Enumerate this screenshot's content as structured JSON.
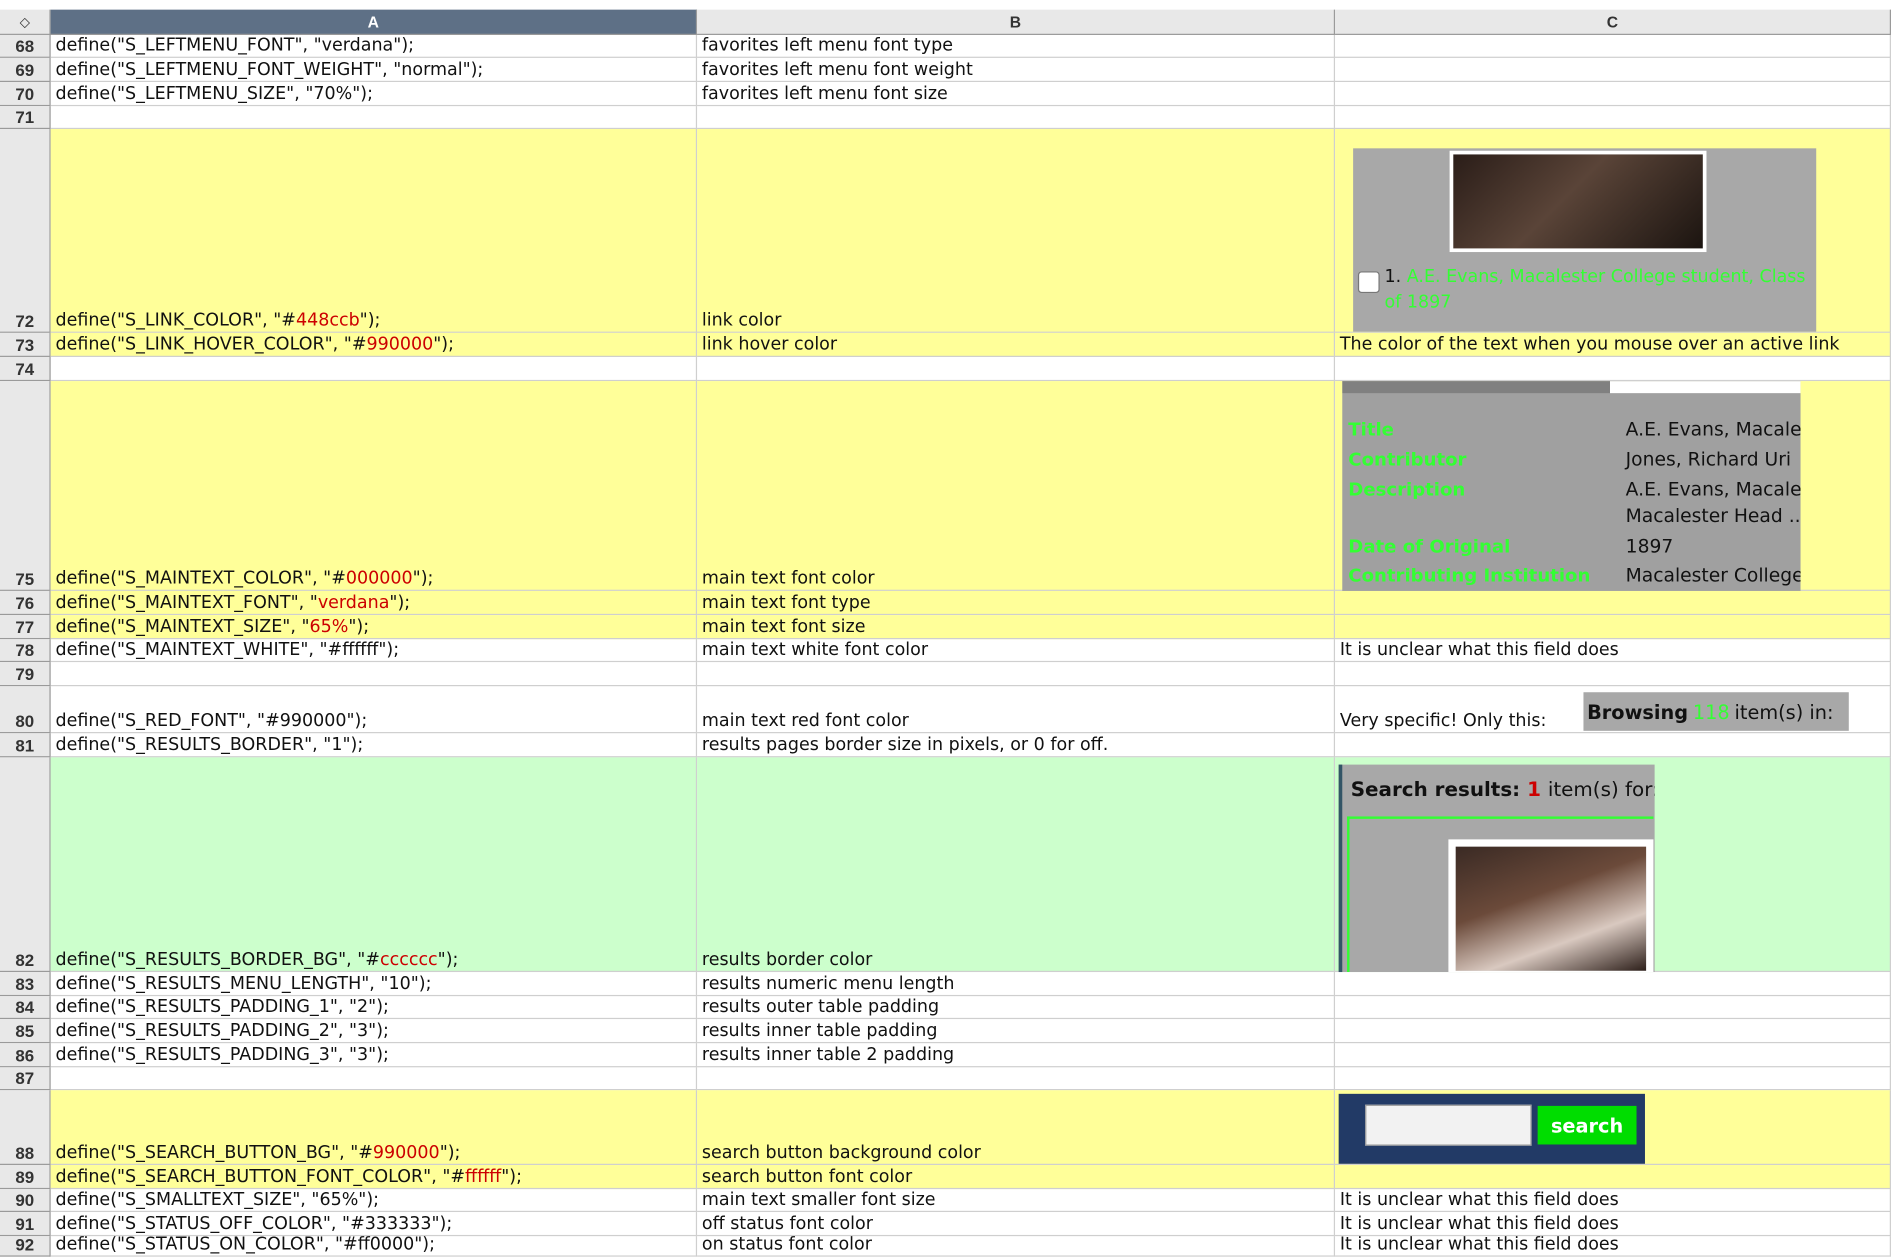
{
  "columns": [
    "A",
    "B",
    "C"
  ],
  "corner_label": "◇",
  "rows": [
    {
      "num": "68",
      "a": "define(\"S_LEFTMENU_FONT\", \"verdana\");",
      "b": "favorites left menu font type",
      "c": ""
    },
    {
      "num": "69",
      "a": "define(\"S_LEFTMENU_FONT_WEIGHT\", \"normal\");",
      "b": "favorites left menu font weight",
      "c": ""
    },
    {
      "num": "70",
      "a": "define(\"S_LEFTMENU_SIZE\", \"70%\");",
      "b": "favorites left menu font size",
      "c": ""
    },
    {
      "num": "71",
      "a": "",
      "b": "",
      "c": ""
    },
    {
      "num": "72",
      "a_pre": "define(\"S_LINK_COLOR\", \"#",
      "a_red": "448ccb",
      "a_post": "\");",
      "b": "link color",
      "c": ""
    },
    {
      "num": "73",
      "a_pre": "define(\"S_LINK_HOVER_COLOR\", \"#",
      "a_red": "990000",
      "a_post": "\");",
      "b": "link hover color",
      "c": "The color of the text when you mouse over an active link"
    },
    {
      "num": "74",
      "a": "",
      "b": "",
      "c": ""
    },
    {
      "num": "75",
      "a_pre": "define(\"S_MAINTEXT_COLOR\", \"#",
      "a_red": "000000",
      "a_post": "\");",
      "b": "main text font color",
      "c": ""
    },
    {
      "num": "76",
      "a_pre": "define(\"S_MAINTEXT_FONT\", \"",
      "a_red": "verdana",
      "a_post": "\");",
      "b": "main text font type",
      "c": ""
    },
    {
      "num": "77",
      "a_pre": "define(\"S_MAINTEXT_SIZE\", \"",
      "a_red": "65%",
      "a_post": "\");",
      "b": "main text font size",
      "c": ""
    },
    {
      "num": "78",
      "a": "define(\"S_MAINTEXT_WHITE\", \"#ffffff\");",
      "b": "main text white font color",
      "c": "It is unclear what this field does"
    },
    {
      "num": "79",
      "a": "",
      "b": "",
      "c": ""
    },
    {
      "num": "80",
      "a": "define(\"S_RED_FONT\", \"#990000\");",
      "b": "main text red font color",
      "c": "Very specific! Only this:"
    },
    {
      "num": "81",
      "a": "define(\"S_RESULTS_BORDER\", \"1\");",
      "b": "results pages border size in pixels, or 0 for off.",
      "c": ""
    },
    {
      "num": "82",
      "a_pre": "define(\"S_RESULTS_BORDER_BG\", \"#",
      "a_red": "cccccc",
      "a_post": "\");",
      "b": "results border color",
      "c": ""
    },
    {
      "num": "83",
      "a": "define(\"S_RESULTS_MENU_LENGTH\", \"10\");",
      "b": "results numeric menu length",
      "c": ""
    },
    {
      "num": "84",
      "a": "define(\"S_RESULTS_PADDING_1\", \"2\");",
      "b": " results outer table padding",
      "c": ""
    },
    {
      "num": "85",
      "a": "define(\"S_RESULTS_PADDING_2\", \"3\");",
      "b": " results inner table padding",
      "c": ""
    },
    {
      "num": "86",
      "a": "define(\"S_RESULTS_PADDING_3\", \"3\");",
      "b": "results inner table 2 padding",
      "c": ""
    },
    {
      "num": "87",
      "a": "",
      "b": "",
      "c": ""
    },
    {
      "num": "88",
      "a_pre": "define(\"S_SEARCH_BUTTON_BG\", \"#",
      "a_red": "990000",
      "a_post": "\");",
      "b": " search button background color",
      "c": ""
    },
    {
      "num": "89",
      "a_pre": "define(\"S_SEARCH_BUTTON_FONT_COLOR\", \"#",
      "a_red": "ffffff",
      "a_post": "\");",
      "b": "search button font color",
      "c": ""
    },
    {
      "num": "90",
      "a": "define(\"S_SMALLTEXT_SIZE\", \"65%\");",
      "b": "main text smaller font size",
      "c": "It is unclear what this field does"
    },
    {
      "num": "91",
      "a": "define(\"S_STATUS_OFF_COLOR\", \"#333333\");",
      "b": "off status font color",
      "c": "It is unclear what this field does"
    },
    {
      "num": "92",
      "a": "define(\"S_STATUS_ON_COLOR\", \"#ff0000\");",
      "b": "on status font color",
      "c": "It is unclear what this field does"
    }
  ],
  "embed_link": {
    "number": "1.",
    "text": "A.E. Evans, Macalester College student, Class of 1897"
  },
  "embed_meta": {
    "labels": [
      "Title",
      "Contributor",
      "Description",
      "",
      "Date of Original",
      "Contributing Institution"
    ],
    "values": [
      "A.E. Evans, Macalester",
      "Jones, Richard Uri",
      "A.E. Evans, Macalester",
      "Macalester Head ...",
      "1897",
      "Macalester College"
    ]
  },
  "embed_browse": {
    "prefix": "Browsing",
    "count": "118",
    "suffix": "item(s) in:"
  },
  "embed_results": {
    "prefix": "Search results:",
    "count": "1",
    "suffix": "item(s) for:"
  },
  "embed_search": {
    "button_label": "search"
  },
  "colors": {
    "yellow": "#ffff99",
    "green": "#ccffcc",
    "red": "#cc0000",
    "highlight_green": "#33ff33"
  }
}
